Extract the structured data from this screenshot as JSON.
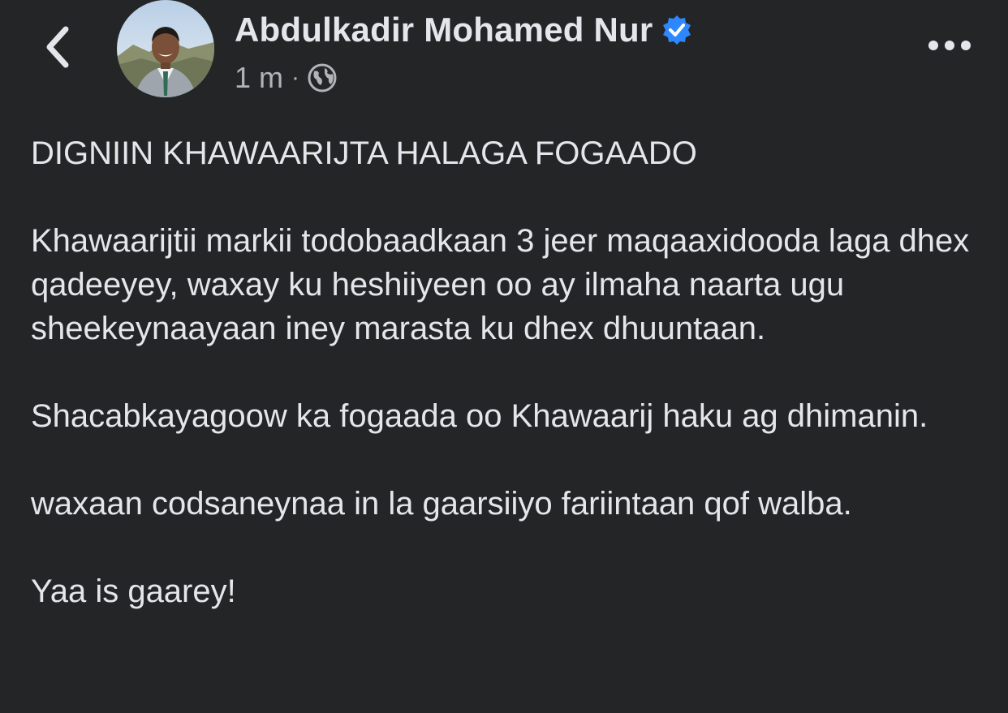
{
  "header": {
    "author_name": "Abdulkadir Mohamed Nur",
    "timestamp": "1 m",
    "separator": "·",
    "audience_icon": "globe-icon",
    "back_icon": "chevron-left-icon",
    "more_icon": "more-horizontal-icon",
    "verified_icon": "verified-badge-icon"
  },
  "post": {
    "paragraphs": [
      "DIGNIIN KHAWAARIJTA HALAGA FOGAADO",
      "Khawaarijtii markii todobaadkaan 3 jeer maqaaxidooda laga dhex qadeeyey, waxay ku heshiiyeen oo ay ilmaha naarta ugu sheekeynaayaan iney marasta ku dhex dhuuntaan.",
      "Shacabkayagoow ka fogaada oo Khawaarij haku ag dhimanin.",
      "waxaan codsaneynaa in la gaarsiiyo fariintaan qof walba.",
      "Yaa is gaarey!"
    ]
  },
  "colors": {
    "background": "#242526",
    "primary_text": "#e4e6eb",
    "secondary_text": "#b0b3b8",
    "verified_blue": "#2d88ff"
  }
}
